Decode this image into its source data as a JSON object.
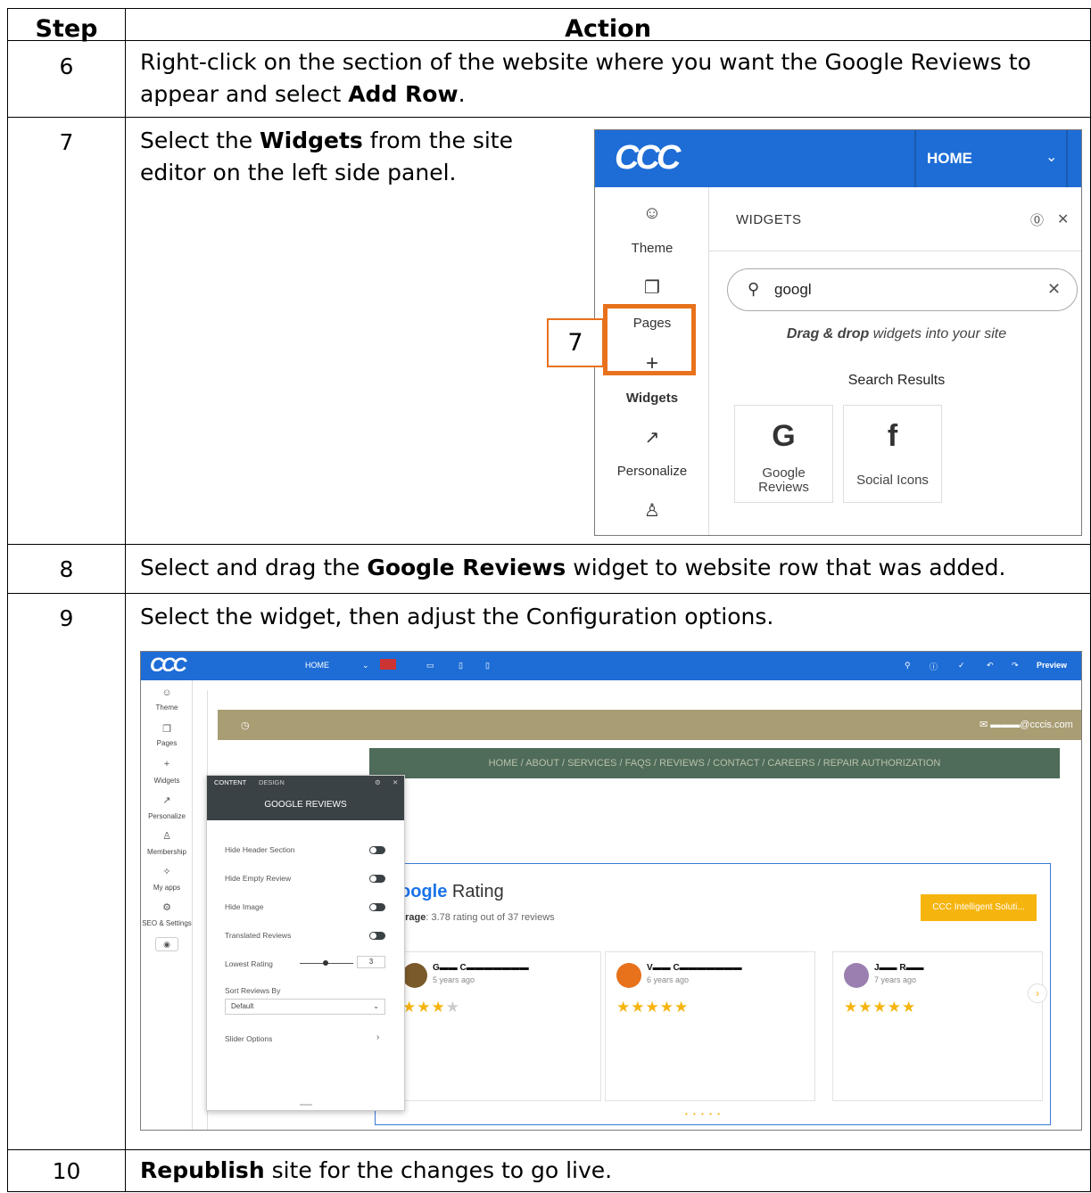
{
  "table": {
    "header": {
      "step": "Step",
      "action": "Action"
    },
    "rows": [
      {
        "step": "6",
        "parts": [
          "Right-click on the section of the website where you want the Google Reviews to appear and select ",
          "Add Row",
          "."
        ]
      },
      {
        "step": "7",
        "parts": [
          "Select the ",
          "Widgets",
          " from the site editor on the left side panel."
        ]
      },
      {
        "step": "8",
        "parts": [
          "Select and drag the ",
          "Google Reviews",
          " widget to website row that was added."
        ]
      },
      {
        "step": "9",
        "text": "Select the widget, then adjust the Configuration options."
      },
      {
        "step": "10",
        "parts": [
          "",
          "Republish",
          " site for the changes to go live."
        ]
      }
    ]
  },
  "callout": {
    "number": "7",
    "color": "#e8711c"
  },
  "screenshot1": {
    "brand_color": "#1e6dd6",
    "logo": "CCC",
    "page_select": "HOME",
    "sidebar": [
      {
        "label": "Theme",
        "icon": "palette-icon"
      },
      {
        "label": "Pages",
        "icon": "pages-icon"
      },
      {
        "label": "Widgets",
        "icon": "plus-icon"
      },
      {
        "label": "Personalize",
        "icon": "personalize-icon"
      },
      {
        "label": "",
        "icon": "user-icon"
      }
    ],
    "panel_title": "WIDGETS",
    "search_value": "googl",
    "drag_hint_em": "Drag & drop",
    "drag_hint_rest": " widgets into your site",
    "results_label": "Search Results",
    "results": [
      {
        "label_line1": "Google",
        "label_line2": "Reviews",
        "icon": "google-reviews-icon"
      },
      {
        "label_line1": "Social Icons",
        "label_line2": "",
        "icon": "social-icons-icon"
      }
    ]
  },
  "screenshot2": {
    "logo": "CCC",
    "page_select": "HOME",
    "preview_label": "Preview",
    "sidebar": [
      "Theme",
      "Pages",
      "Widgets",
      "Personalize",
      "Membership",
      "My apps",
      "SEO & Settings"
    ],
    "email_suffix": "@cccis.com",
    "nav": "HOME  /  ABOUT  /  SERVICES  /  FAQS  /  REVIEWS  /  CONTACT  /  CAREERS  /  REPAIR AUTHORIZATION",
    "rating_title_brand": "oogle",
    "rating_title_rest": " Rating",
    "average_label": "erage",
    "average_text": ": 3.78 rating out of 37 reviews",
    "cta": "CCC Intelligent Soluti...",
    "reviews": [
      {
        "name": "G▬▬ C▬▬▬▬▬▬▬",
        "time": "5 years ago",
        "stars": 3
      },
      {
        "name": "V▬▬ C▬▬▬▬▬▬▬",
        "time": "6 years ago",
        "stars": 5
      },
      {
        "name": "J▬▬ R▬▬",
        "time": "7 years ago",
        "stars": 5
      }
    ],
    "panel": {
      "tab_content": "CONTENT",
      "tab_design": "DESIGN",
      "title": "GOOGLE REVIEWS",
      "options": [
        "Hide Header Section",
        "Hide Empty Review",
        "Hide Image",
        "Translated Reviews"
      ],
      "lowest_rating_label": "Lowest Rating",
      "lowest_rating_value": "3",
      "sort_label": "Sort Reviews By",
      "sort_value": "Default",
      "slider_label": "Slider Options"
    }
  }
}
